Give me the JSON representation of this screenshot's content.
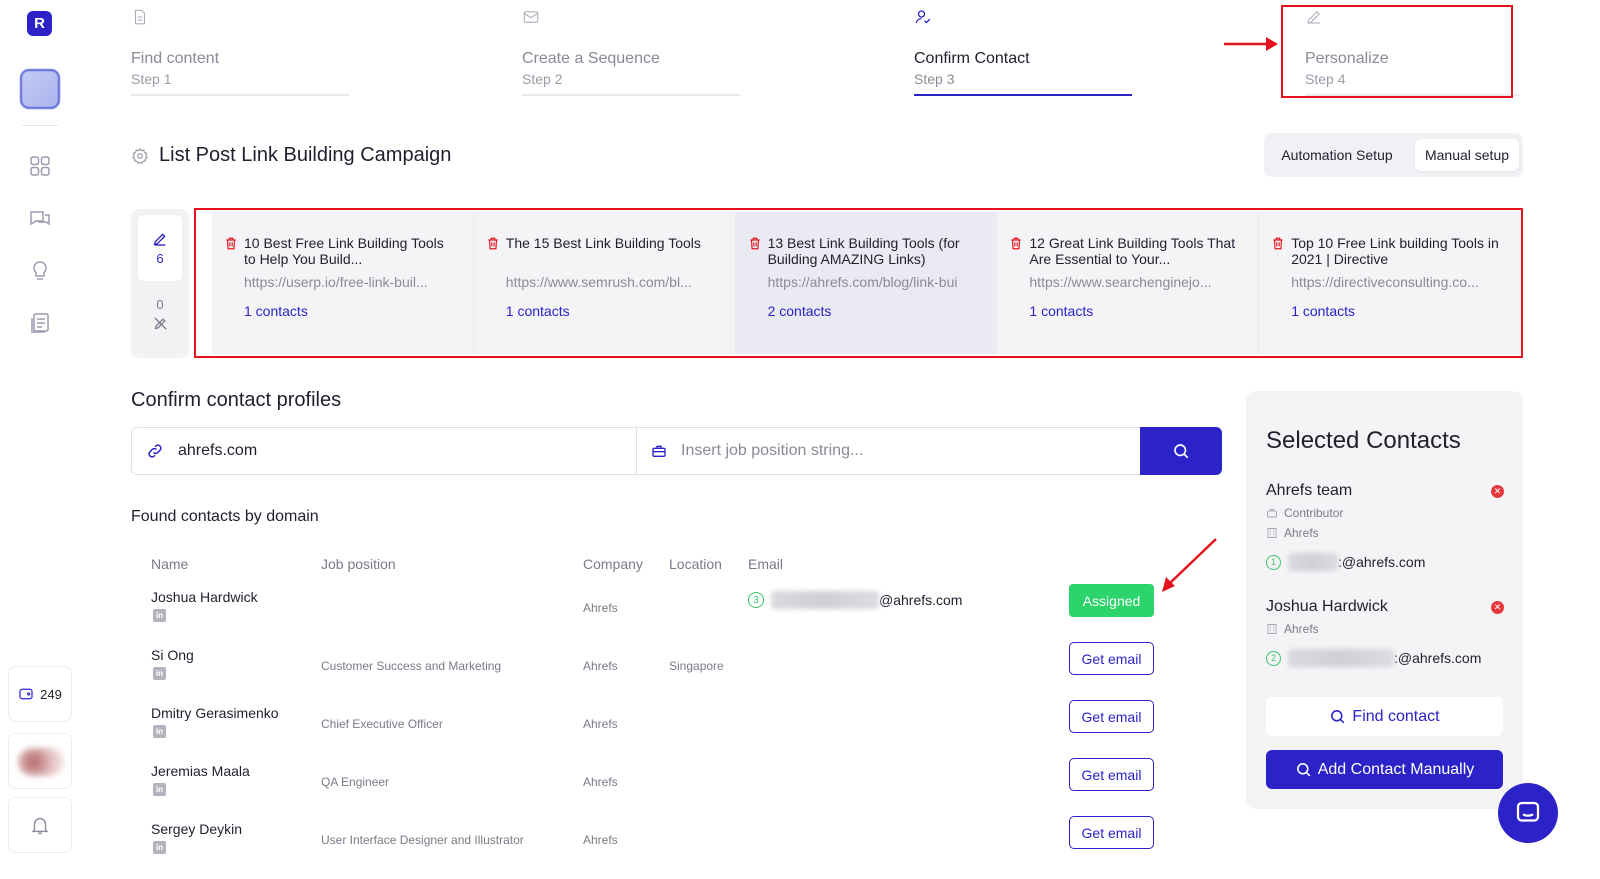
{
  "sidebar": {
    "logo_letter": "R",
    "credits": "249",
    "icons": [
      "dashboard-icon",
      "chat-icon",
      "lightbulb-icon",
      "news-icon",
      "wallet-icon",
      "bell-icon"
    ]
  },
  "steps": [
    {
      "title": "Find content",
      "sub": "Step 1",
      "icon": "document-icon"
    },
    {
      "title": "Create a Sequence",
      "sub": "Step 2",
      "icon": "mail-icon"
    },
    {
      "title": "Confirm Contact",
      "sub": "Step 3",
      "icon": "user-check-icon",
      "active": true
    },
    {
      "title": "Personalize",
      "sub": "Step 4",
      "icon": "pencil-icon"
    }
  ],
  "campaign": {
    "title": "List Post Link Building Campaign",
    "setup_options": {
      "automation": "Automation Setup",
      "manual": "Manual setup"
    },
    "selected_setup": "manual"
  },
  "counters": {
    "edited": "6",
    "unassigned": "0"
  },
  "content_cards": [
    {
      "title": "10 Best Free Link Building Tools to Help You Build...",
      "url": "https://userp.io/free-link-buil...",
      "contacts": "1 contacts"
    },
    {
      "title": "The 15 Best Link Building Tools",
      "url": "https://www.semrush.com/bl...",
      "contacts": "1 contacts"
    },
    {
      "title": "13 Best Link Building Tools (for Building AMAZING Links)",
      "url": "https://ahrefs.com/blog/link-bui",
      "contacts": "2 contacts",
      "selected": true
    },
    {
      "title": "12 Great Link Building Tools That Are Essential to Your...",
      "url": "https://www.searchenginejo...",
      "contacts": "1 contacts"
    },
    {
      "title": "Top 10 Free Link building Tools in 2021 | Directive",
      "url": "https://directiveconsulting.co...",
      "contacts": "1 contacts"
    }
  ],
  "confirm": {
    "title": "Confirm contact profiles",
    "domain_value": "ahrefs.com",
    "job_placeholder": "Insert job position string...",
    "found_title": "Found contacts by domain"
  },
  "table": {
    "headers": {
      "name": "Name",
      "job": "Job position",
      "company": "Company",
      "location": "Location",
      "email": "Email"
    },
    "rows": [
      {
        "name": "Joshua Hardwick",
        "job": "",
        "company": "Ahrefs",
        "location": "",
        "email_count": "3",
        "email_domain": "@ahrefs.com",
        "action": "Assigned"
      },
      {
        "name": "Si Ong",
        "job": "Customer Success and Marketing",
        "company": "Ahrefs",
        "location": "Singapore",
        "action": "Get email"
      },
      {
        "name": "Dmitry Gerasimenko",
        "job": "Chief Executive Officer",
        "company": "Ahrefs",
        "location": "",
        "action": "Get email"
      },
      {
        "name": "Jeremias Maala",
        "job": "QA Engineer",
        "company": "Ahrefs",
        "location": "",
        "action": "Get email"
      },
      {
        "name": "Sergey Deykin",
        "job": "User Interface Designer and Illustrator",
        "company": "Ahrefs",
        "location": "",
        "action": "Get email"
      }
    ]
  },
  "selected": {
    "title": "Selected Contacts",
    "contacts": [
      {
        "name": "Ahrefs team",
        "role": "Contributor",
        "company": "Ahrefs",
        "email_count": "1",
        "email_domain": ":@ahrefs.com"
      },
      {
        "name": "Joshua Hardwick",
        "company": "Ahrefs",
        "email_count": "2",
        "email_domain": ":@ahrefs.com"
      }
    ],
    "find_label": "Find contact",
    "add_label": "Add Contact Manually"
  },
  "colors": {
    "brand": "#2b22c8",
    "assigned": "#2bd56b",
    "highlight": "#e3141e"
  }
}
